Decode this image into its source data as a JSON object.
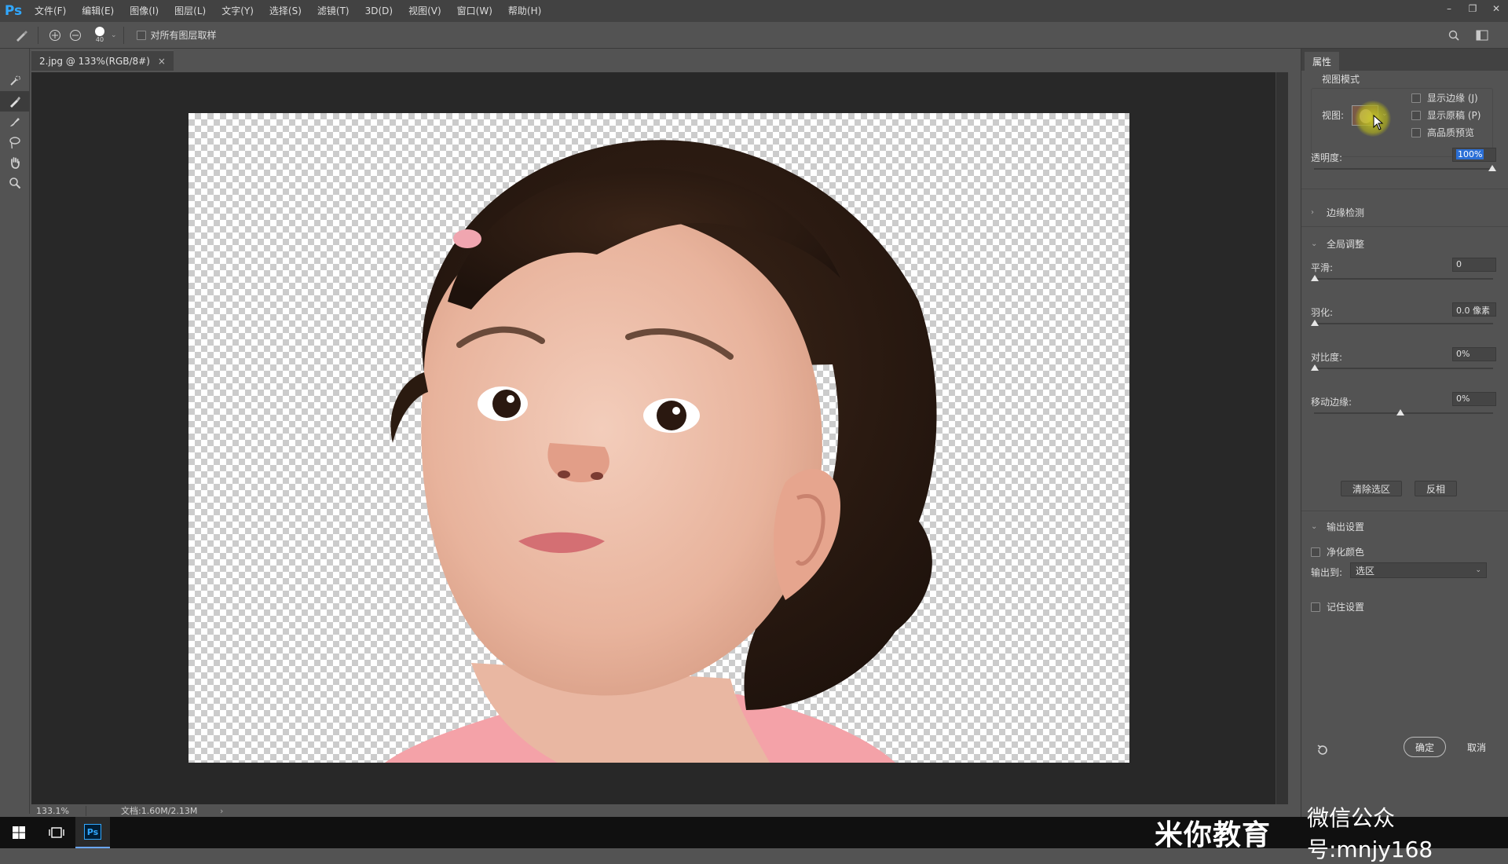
{
  "app": {
    "logo": "Ps",
    "menu": [
      "文件(F)",
      "编辑(E)",
      "图像(I)",
      "图层(L)",
      "文字(Y)",
      "选择(S)",
      "滤镜(T)",
      "3D(D)",
      "视图(V)",
      "窗口(W)",
      "帮助(H)"
    ],
    "window_controls": [
      "–",
      "❐",
      "✕"
    ]
  },
  "options_bar": {
    "brush_size": "40",
    "sample_all_layers_label": "对所有图层取样"
  },
  "document": {
    "tab_title": "2.jpg @ 133%(RGB/8#)",
    "tab_close": "×"
  },
  "status": {
    "zoom": "133.1%",
    "doc_info": "文档:1.60M/2.13M",
    "arrow": "›"
  },
  "properties": {
    "tab": "属性",
    "view_mode_title": "视图模式",
    "view_label": "视图:",
    "show_edge": "显示边缘 (J)",
    "show_original": "显示原稿 (P)",
    "high_quality_preview": "高品质预览",
    "opacity_label": "透明度:",
    "opacity_value": "100%",
    "opacity_fraction": 1.0,
    "edge_detection": "边缘检测",
    "global_refine": "全局调整",
    "smooth_label": "平滑:",
    "smooth_value": "0",
    "feather_label": "羽化:",
    "feather_value": "0.0 像素",
    "contrast_label": "对比度:",
    "contrast_value": "0%",
    "shift_edge_label": "移动边缘:",
    "shift_edge_value": "0%",
    "clear_selection": "清除选区",
    "invert": "反相",
    "output_settings": "输出设置",
    "decontaminate": "净化颜色",
    "output_to_label": "输出到:",
    "output_to_value": "选区",
    "remember_settings": "记住设置",
    "ok": "确定",
    "cancel": "取消"
  },
  "taskbar": {
    "ps_label": "Ps",
    "watermark_brand": "米你教育",
    "watermark_wechat": "微信公众号:mnjy168"
  },
  "colors": {
    "accent": "#31a8ff",
    "panel_bg": "#535353",
    "canvas_bg": "#282828",
    "highlight": "#2b6fd6"
  }
}
